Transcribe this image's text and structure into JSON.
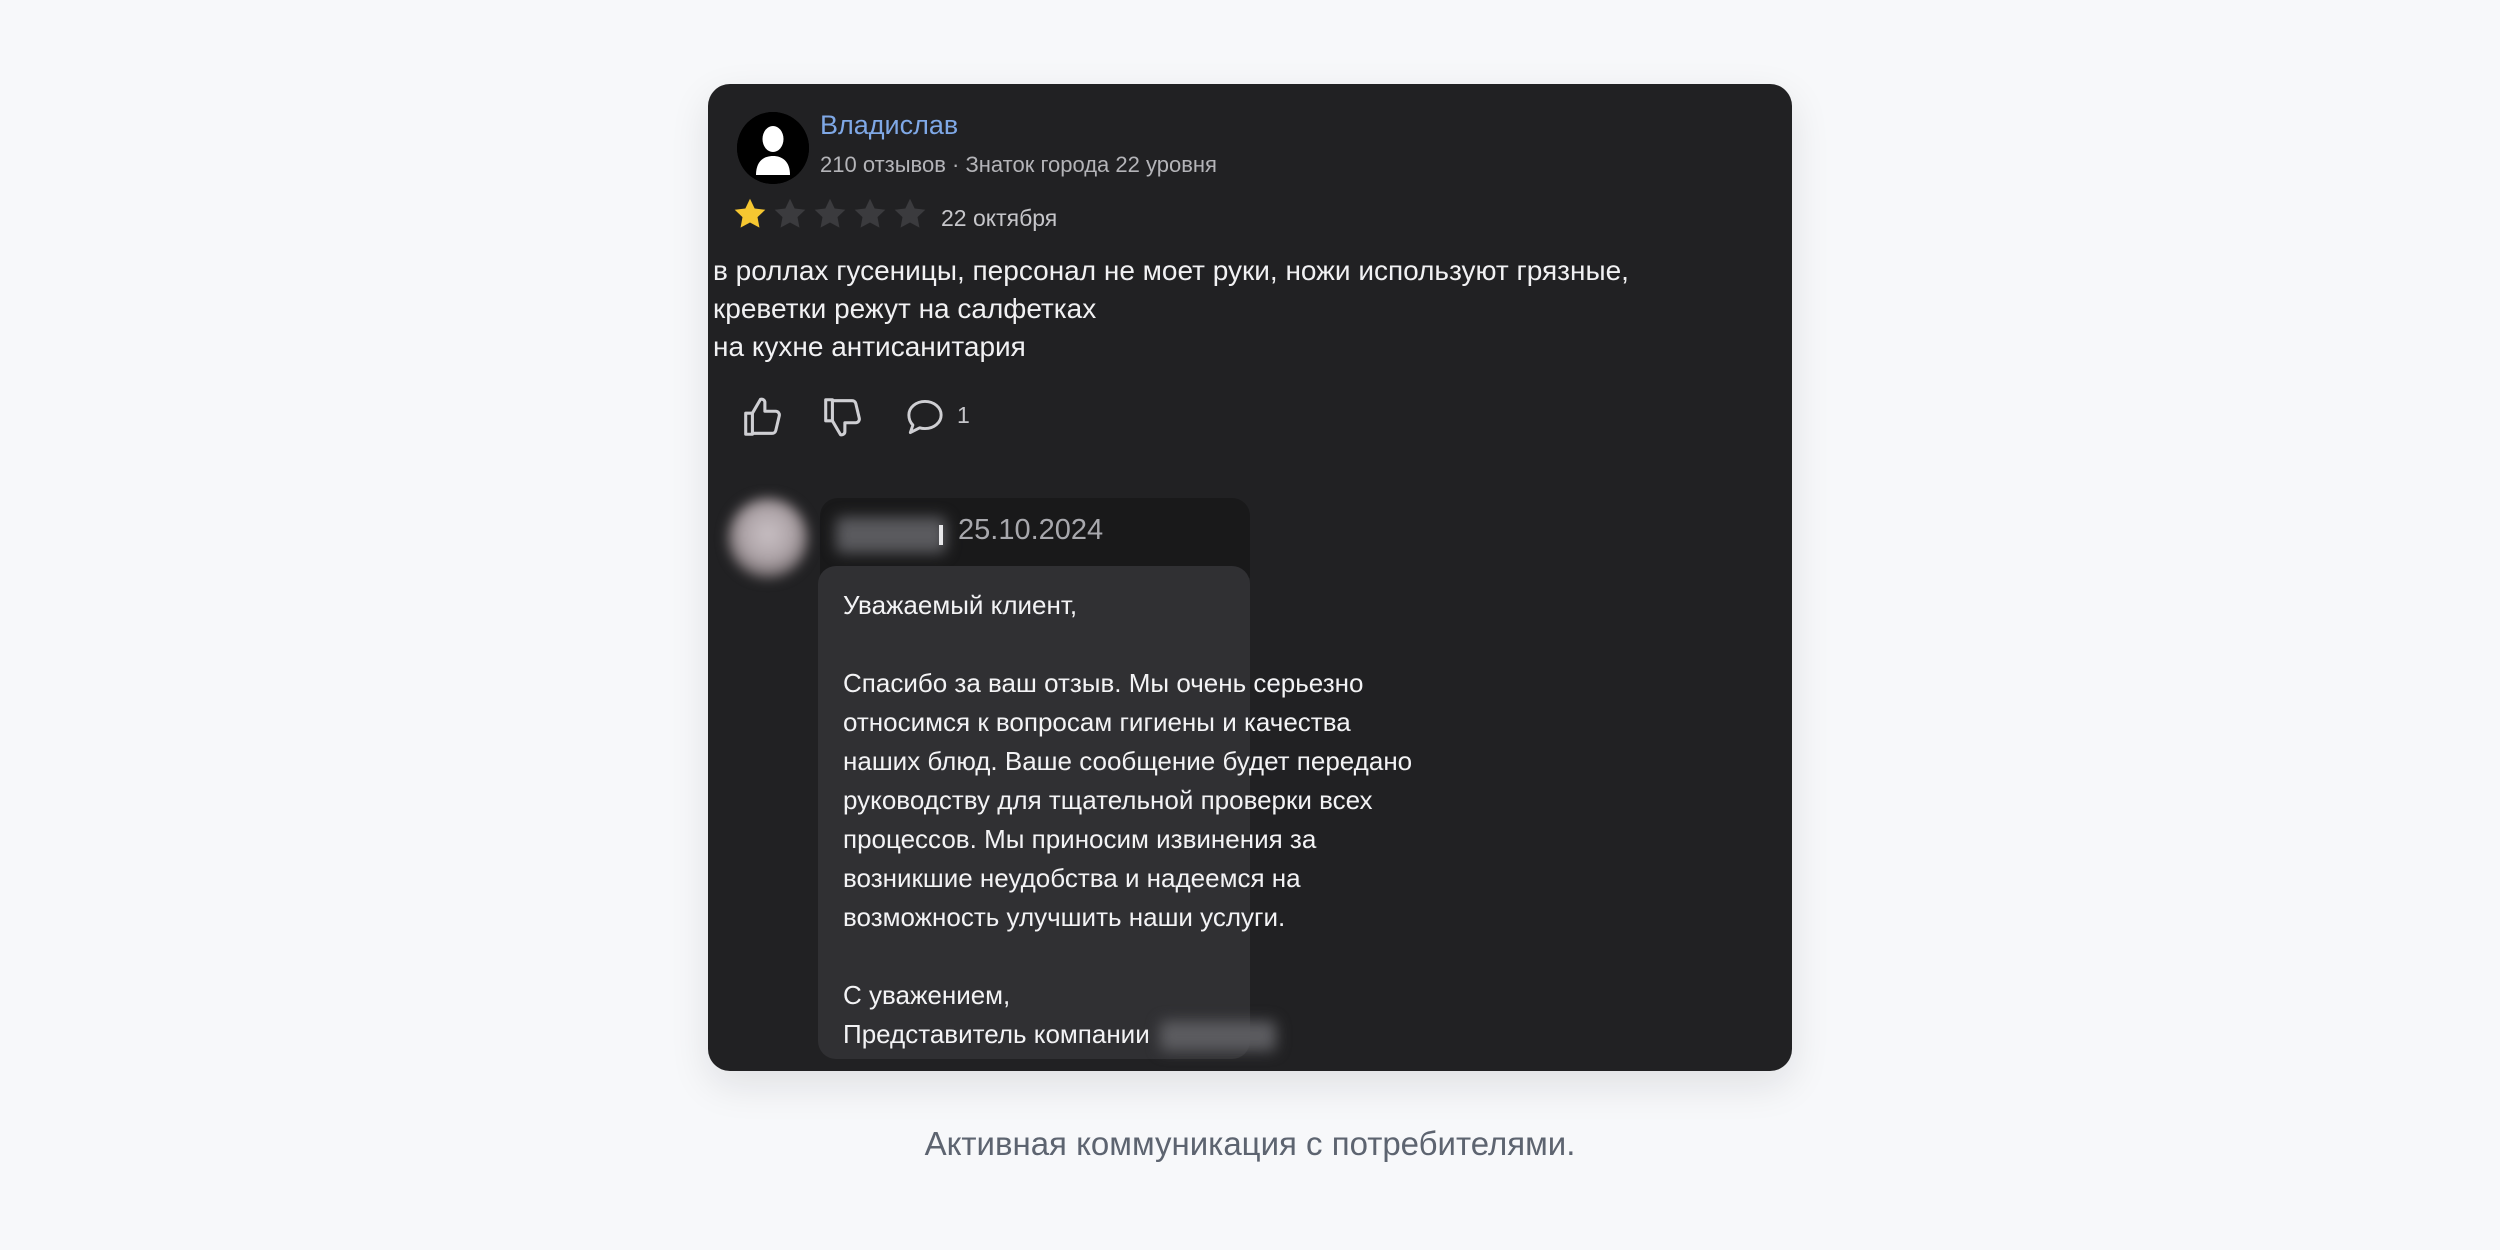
{
  "review": {
    "author_name": "Владислав",
    "author_meta": "210 отзывов · Знаток города 22 уровня",
    "rating": 1,
    "rating_max": 5,
    "date": "22 октября",
    "text_lines": [
      "в роллах гусеницы, персонал не моет руки, ножи используют грязные,",
      "креветки режут на салфетках",
      "на кухне антисанитария"
    ],
    "comment_count": "1"
  },
  "reply": {
    "date": "25.10.2024",
    "greeting": "Уважаемый клиент,",
    "body_lines": [
      "Спасибо за ваш отзыв. Мы очень серьезно",
      "относимся к вопросам гигиены и качества",
      "наших блюд. Ваше сообщение будет передано",
      "руководству для тщательной проверки всех",
      "процессов. Мы приносим извинения за",
      "возникшие неудобства и надеемся на",
      "возможность улучшить наши услуги."
    ],
    "closing": "С уважением,",
    "signature": "Представитель компании"
  },
  "caption": "Активная коммуникация с потребителями.",
  "colors": {
    "card_bg": "#212123",
    "author_link": "#7fa8e6",
    "star_filled": "#f6c731",
    "star_empty": "#3b3b3e",
    "reply_bubble": "#303033"
  },
  "icons": [
    "user-avatar-icon",
    "star-icon",
    "thumbs-up-icon",
    "thumbs-down-icon",
    "comment-icon"
  ]
}
